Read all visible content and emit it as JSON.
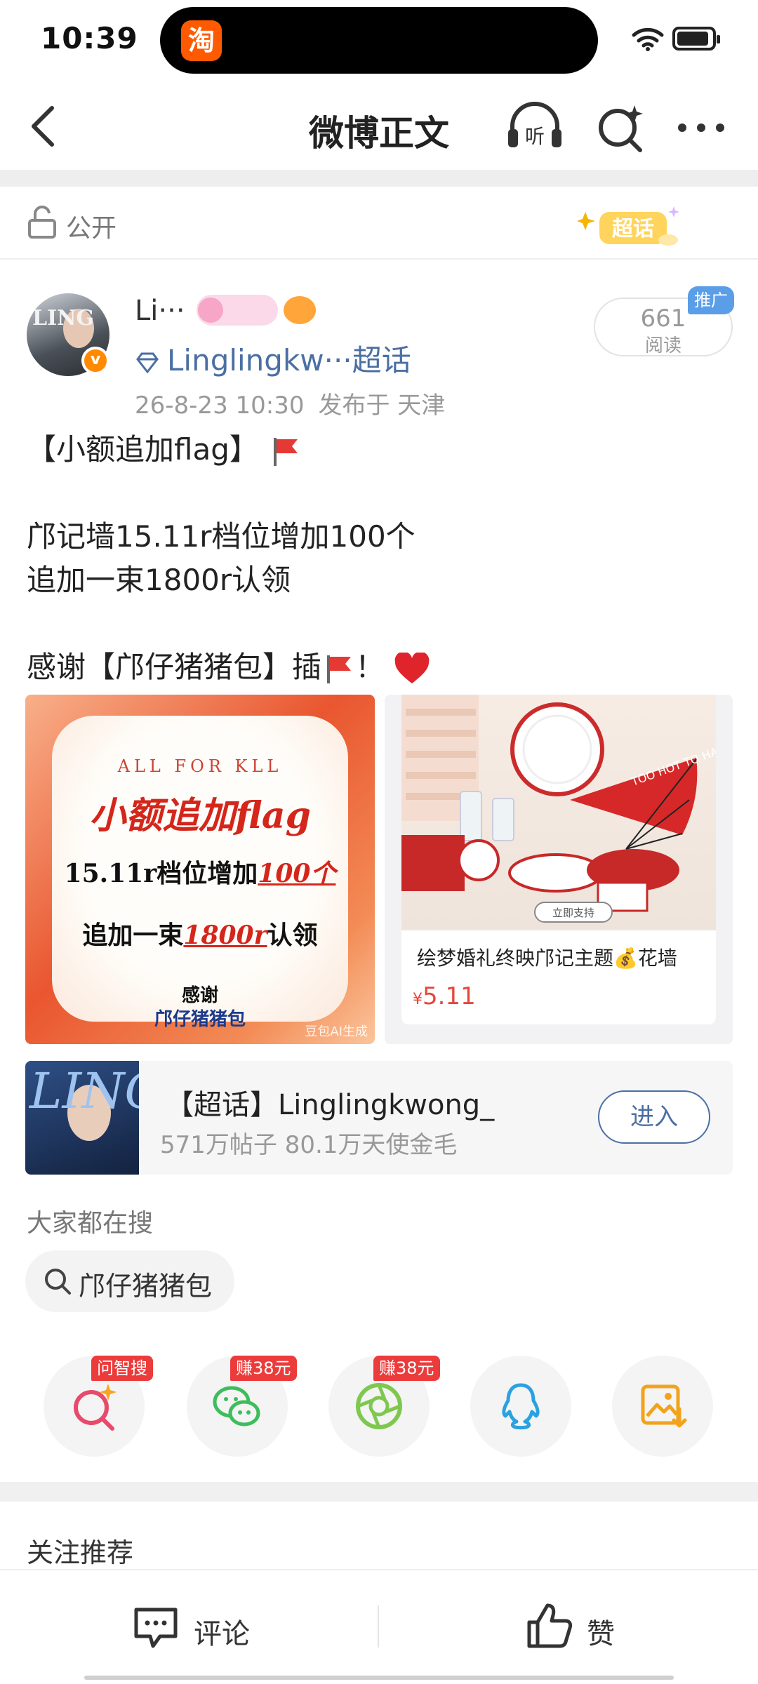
{
  "status_bar": {
    "time": "10:39",
    "app_icon_glyph": "淘"
  },
  "nav": {
    "title": "微博正文",
    "listen_label": "听"
  },
  "visibility": {
    "label": "公开",
    "badge": "超话"
  },
  "author": {
    "name": "Li···",
    "verified_glyph": "v",
    "avatar_text": "LING",
    "super_topic": "Linglingkw···超话",
    "posted_at": "26-8-23 10:30",
    "location": "发布于 天津",
    "read_count": "661",
    "read_label": "阅读",
    "promo_tag": "推广"
  },
  "post": {
    "line1": "【小额追加flag】",
    "line2": "邝记墙15.11r档位增加100个",
    "line3": "追加一束1800r认领",
    "line4_a": "感谢【邝仔猪猪包】插",
    "line4_b": "！"
  },
  "image_left": {
    "top": "ALL FOR KLL",
    "headline": "小额追加flag",
    "line1_a": "15.11r档位增加",
    "line1_b": "100个",
    "line2_a": "追加一束",
    "line2_b": "1800r",
    "line2_c": "认领",
    "thanks": "感谢",
    "donor": "邝仔猪猪包",
    "watermark": "豆包AI生成"
  },
  "image_right": {
    "fan_text": "TOO HOT TO HANDLE",
    "support_btn": "立即支持",
    "title": "绘梦婚礼终映邝记主题💰花墙",
    "currency": "¥",
    "price": "5.11"
  },
  "topic_card": {
    "cover_text": "LING",
    "name": "【超话】Linglingkwong_",
    "stats": "571万帖子 80.1万天使金毛",
    "enter": "进入"
  },
  "search": {
    "heading": "大家都在搜",
    "chip": "邝仔猪猪包"
  },
  "share": {
    "tags": [
      "问智搜",
      "赚38元",
      "赚38元"
    ],
    "icons": [
      "ai-search-icon",
      "wechat-icon",
      "moments-icon",
      "qq-icon",
      "save-image-icon"
    ]
  },
  "recommend": {
    "heading": "关注推荐"
  },
  "bottom_bar": {
    "comment": "评论",
    "like": "赞"
  },
  "colors": {
    "accent_blue": "#4b6fa3",
    "red_tag": "#ec3b3b",
    "price_red": "#e5473c",
    "taobao_orange": "#ff5a00"
  }
}
